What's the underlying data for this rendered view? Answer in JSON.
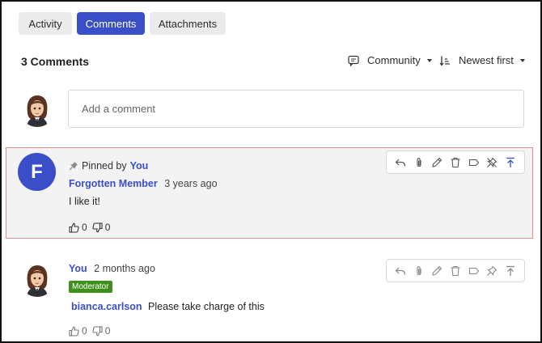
{
  "tabs": [
    {
      "label": "Activity",
      "active": false
    },
    {
      "label": "Comments",
      "active": true
    },
    {
      "label": "Attachments",
      "active": false
    }
  ],
  "header": {
    "count_label": "3 Comments",
    "community_label": "Community",
    "sort_label": "Newest first"
  },
  "composer": {
    "placeholder": "Add a comment"
  },
  "comments": [
    {
      "pinned_prefix": "Pinned by",
      "pinned_by": "You",
      "avatar_letter": "F",
      "author": "Forgotten Member",
      "time": "3 years ago",
      "body": "I like it!",
      "upvotes": "0",
      "downvotes": "0"
    },
    {
      "author": "You",
      "time": "2 months ago",
      "badge": "Moderator",
      "mention": "bianca.carlson",
      "body": "Please take charge of this",
      "upvotes": "0",
      "downvotes": "0"
    }
  ],
  "colors": {
    "accent": "#3a4fc7",
    "moderator": "#3f8f1c",
    "pinned_border": "#e58a8a"
  }
}
